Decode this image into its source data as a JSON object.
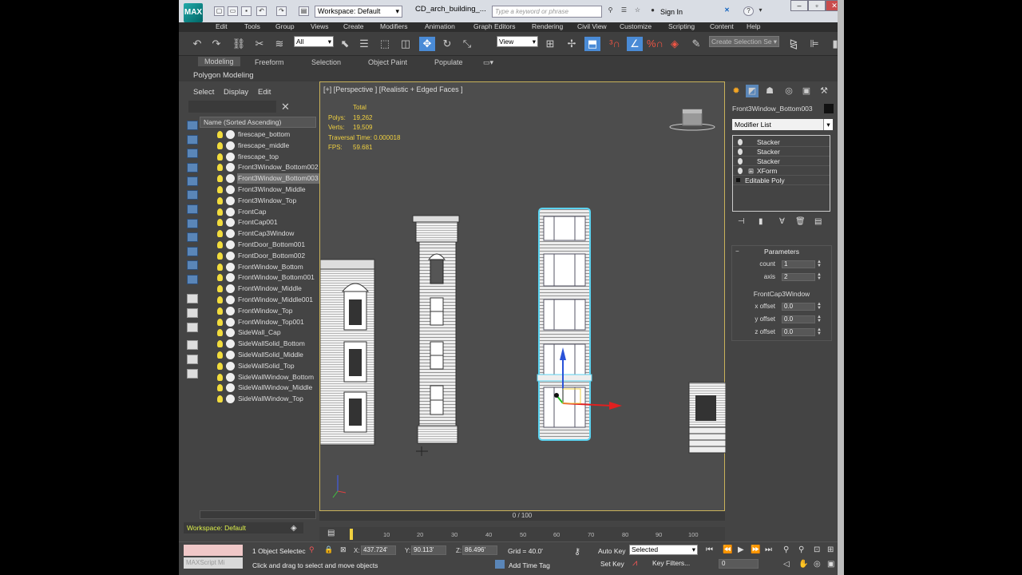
{
  "title_bar": {
    "logo": "MAX",
    "workspace": "Workspace: Default",
    "document": "CD_arch_building_...",
    "search_placeholder": "Type a keyword or phrase",
    "sign_in": "Sign In"
  },
  "menu": [
    "Edit",
    "Tools",
    "Group",
    "Views",
    "Create",
    "Modifiers",
    "Animation",
    "Graph Editors",
    "Rendering",
    "Civil View",
    "Customize",
    "Scripting",
    "Content",
    "Help"
  ],
  "toolbar": {
    "filter": "All",
    "ref_coord": "View",
    "named_sel_placeholder": "Create Selection Se"
  },
  "ribbon": {
    "tabs": [
      "Modeling",
      "Freeform",
      "Selection",
      "Object Paint",
      "Populate"
    ],
    "active": "Modeling",
    "panel": "Polygon Modeling"
  },
  "scene_explorer": {
    "menu": [
      "Select",
      "Display",
      "Edit"
    ],
    "column": "Name (Sorted Ascending)",
    "items": [
      "firescape_bottom",
      "firescape_middle",
      "firescape_top",
      "Front3Window_Bottom002",
      "Front3Window_Bottom003",
      "Front3Window_Middle",
      "Front3Window_Top",
      "FrontCap",
      "FrontCap001",
      "FrontCap3Window",
      "FrontDoor_Bottom001",
      "FrontDoor_Bottom002",
      "FrontWindow_Bottom",
      "FrontWindow_Bottom001",
      "FrontWindow_Middle",
      "FrontWindow_Middle001",
      "FrontWindow_Top",
      "FrontWindow_Top001",
      "SideWall_Cap",
      "SideWallSolid_Bottom",
      "SideWallSolid_Middle",
      "SideWallSolid_Top",
      "SideWallWindow_Bottom",
      "SideWallWindow_Middle",
      "SideWallWindow_Top"
    ],
    "selected_index": 4,
    "workspace": "Workspace: Default"
  },
  "viewport": {
    "label": "[+] [Perspective ] [Realistic + Edged Faces ]",
    "stats": {
      "header": "Total",
      "polys_label": "Polys:",
      "polys": "19,262",
      "verts_label": "Verts:",
      "verts": "19,509",
      "traversal_label": "Traversal Time:",
      "traversal": "0.000018",
      "fps_label": "FPS:",
      "fps": "59.681"
    },
    "time": "0 / 100"
  },
  "command_panel": {
    "object_name": "Front3Window_Bottom003",
    "modifier_list": "Modifier List",
    "stack": [
      "Stacker",
      "Stacker",
      "Stacker",
      "XForm",
      "Editable Poly"
    ],
    "params_title": "Parameters",
    "count_label": "count",
    "count": "1",
    "axis_label": "axis",
    "axis": "2",
    "cap_object": "FrontCap3Window",
    "xoff_label": "x offset",
    "xoff": "0.0",
    "yoff_label": "y offset",
    "yoff": "0.0",
    "zoff_label": "z offset",
    "zoff": "0.0"
  },
  "trackbar": {
    "ticks": [
      "10",
      "20",
      "30",
      "40",
      "50",
      "60",
      "70",
      "80",
      "90",
      "100"
    ]
  },
  "status": {
    "mxs": "MAXScript Mi",
    "selection": "1 Object Selectec",
    "hint": "Click and drag to select and move objects",
    "x": "437.724'",
    "y": "90.113'",
    "z": "86.496'",
    "grid": "Grid = 40.0'",
    "add_time_tag": "Add Time Tag",
    "auto_key": "Auto Key",
    "set_key": "Set Key",
    "selected": "Selected",
    "key_filters": "Key Filters...",
    "frame": "0"
  }
}
